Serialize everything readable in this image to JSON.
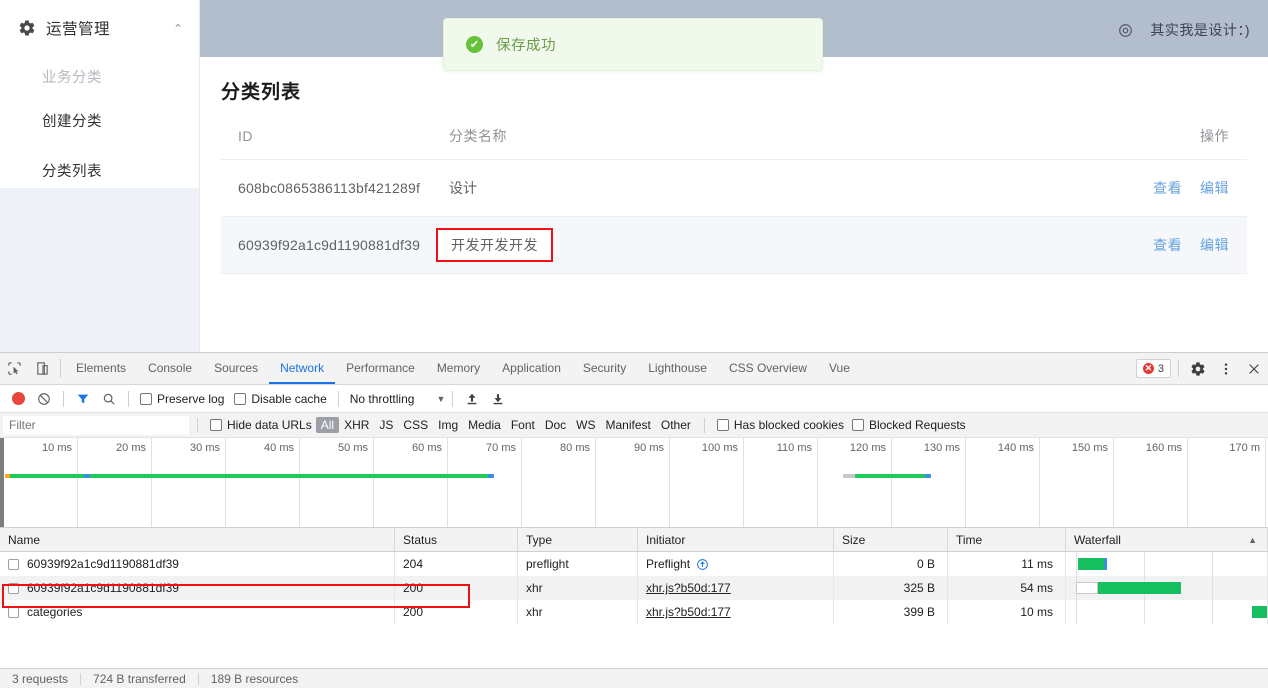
{
  "page": {
    "sidebar": {
      "group": {
        "icon": "gear-icon",
        "label": "运营管理",
        "caret": "chevron-up-icon"
      },
      "items": [
        {
          "label": "业务分类",
          "muted": true
        },
        {
          "label": "创建分类",
          "muted": false
        },
        {
          "label": "分类列表",
          "muted": false
        }
      ]
    },
    "toast": {
      "icon": "check-circle-icon",
      "text": "保存成功"
    },
    "header_right": {
      "icon": "gear-icon",
      "user": "其实我是设计：)"
    },
    "content": {
      "title": "分类列表",
      "columns": [
        "ID",
        "分类名称",
        "操作"
      ],
      "rows": [
        {
          "id": "608bc0865386113bf421289f",
          "name": "设计",
          "highlighted": false,
          "actions": [
            "查看",
            "编辑"
          ]
        },
        {
          "id": "60939f92a1c9d1190881df39",
          "name": "开发开发开发",
          "highlighted": true,
          "actions": [
            "查看",
            "编辑"
          ]
        }
      ]
    }
  },
  "devtools": {
    "tabs": [
      {
        "label": "Elements",
        "active": false
      },
      {
        "label": "Console",
        "active": false
      },
      {
        "label": "Sources",
        "active": false
      },
      {
        "label": "Network",
        "active": true
      },
      {
        "label": "Performance",
        "active": false
      },
      {
        "label": "Memory",
        "active": false
      },
      {
        "label": "Application",
        "active": false
      },
      {
        "label": "Security",
        "active": false
      },
      {
        "label": "Lighthouse",
        "active": false
      },
      {
        "label": "CSS Overview",
        "active": false
      },
      {
        "label": "Vue",
        "active": false
      }
    ],
    "error_count": "3",
    "toolbar": {
      "preserve_log": "Preserve log",
      "disable_cache": "Disable cache",
      "throttling": "No throttling"
    },
    "filter": {
      "placeholder": "Filter",
      "value": "",
      "hide_data_urls": "Hide data URLs",
      "types": [
        "All",
        "XHR",
        "JS",
        "CSS",
        "Img",
        "Media",
        "Font",
        "Doc",
        "WS",
        "Manifest",
        "Other"
      ],
      "active_type": "All",
      "has_blocked_cookies": "Has blocked cookies",
      "blocked_requests": "Blocked Requests"
    },
    "overview": {
      "ticks": [
        "10 ms",
        "20 ms",
        "30 ms",
        "40 ms",
        "50 ms",
        "60 ms",
        "70 ms",
        "80 ms",
        "90 ms",
        "100 ms",
        "110 ms",
        "120 ms",
        "130 ms",
        "140 ms",
        "150 ms",
        "160 ms",
        "170 m"
      ]
    },
    "grid": {
      "columns": [
        "Name",
        "Status",
        "Type",
        "Initiator",
        "Size",
        "Time",
        "Waterfall"
      ],
      "rows": [
        {
          "name": "60939f92a1c9d1190881df39",
          "status": "204",
          "type": "preflight",
          "initiator": "Preflight",
          "initiator_icon": "preflight-info-icon",
          "size": "0 B",
          "time": "11 ms",
          "highlighted": false
        },
        {
          "name": "60939f92a1c9d1190881df39",
          "status": "200",
          "type": "xhr",
          "initiator": "xhr.js?b50d:177",
          "initiator_icon": "",
          "size": "325 B",
          "time": "54 ms",
          "highlighted": true
        },
        {
          "name": "categories",
          "status": "200",
          "type": "xhr",
          "initiator": "xhr.js?b50d:177",
          "initiator_icon": "",
          "size": "399 B",
          "time": "10 ms",
          "highlighted": false
        }
      ]
    },
    "status_bar": {
      "requests": "3 requests",
      "transferred": "724 B transferred",
      "resources": "189 B resources"
    }
  },
  "colors": {
    "accent": "#1a73e8",
    "success": "#67c23a",
    "highlight": "#ee1111",
    "waterfall": "#16c060",
    "link": "#66a3e0"
  }
}
